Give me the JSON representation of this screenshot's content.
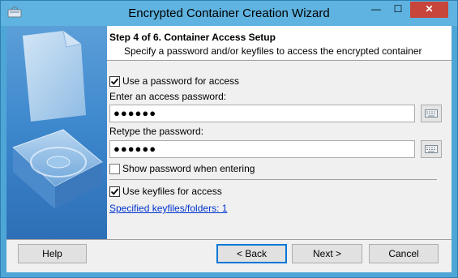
{
  "window": {
    "title": "Encrypted Container Creation Wizard",
    "minimize_glyph": "—",
    "maximize_glyph": "☐",
    "close_glyph": "✕"
  },
  "header": {
    "step_title": "Step 4 of 6. Container Access Setup",
    "step_subtitle": "Specify a password and/or keyfiles to access the encrypted container"
  },
  "form": {
    "use_password_label": "Use a password for access",
    "use_password_checked": true,
    "enter_password_label": "Enter an access password:",
    "enter_password_value": "●●●●●●",
    "retype_password_label": "Retype the password:",
    "retype_password_value": "●●●●●●",
    "show_password_label": "Show password when entering",
    "show_password_checked": false,
    "use_keyfiles_label": "Use keyfiles for access",
    "use_keyfiles_checked": true,
    "keyfiles_link": "Specified keyfiles/folders: 1"
  },
  "buttons": {
    "help": "Help",
    "back": "< Back",
    "next": "Next >",
    "cancel": "Cancel"
  },
  "colors": {
    "titlebar": "#5fb3e0",
    "close": "#c7453a",
    "link": "#0033cc",
    "focus": "#0078d7"
  }
}
